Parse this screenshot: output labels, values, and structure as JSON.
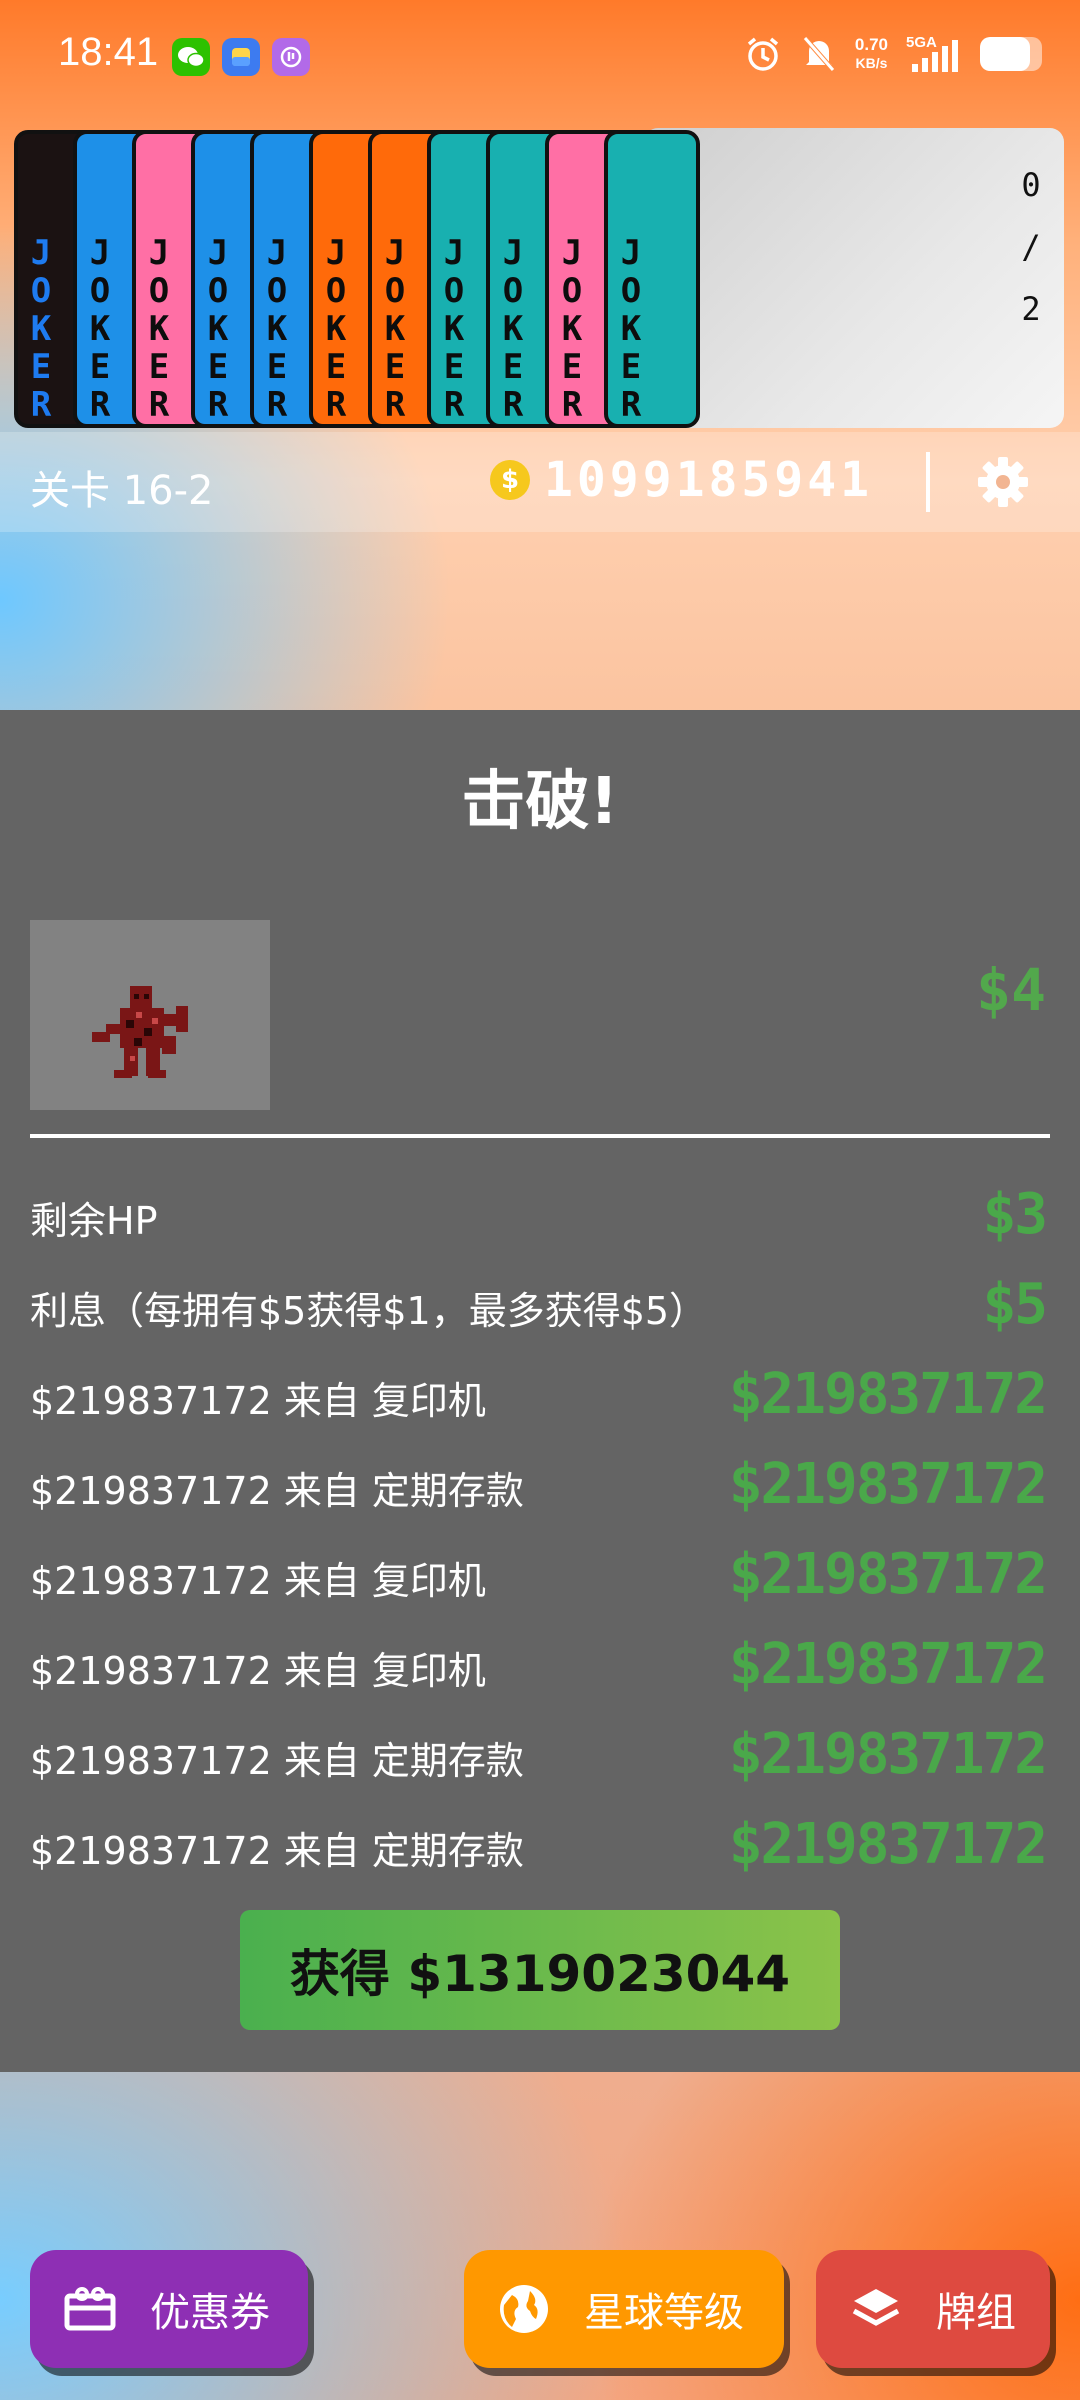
{
  "status_bar": {
    "time": "18:41",
    "net_speed": "0.70",
    "net_unit": "KB/s",
    "network": "5GA",
    "battery_level": 0.8
  },
  "card_strip": {
    "card_label": "JOKER",
    "card_colors": [
      "#1b1212",
      "#1e90e8",
      "#ff6fa5",
      "#1e90e8",
      "#1e90e8",
      "#ff6a0a",
      "#ff6a0a",
      "#18b0b0",
      "#18b0b0",
      "#ff6fa5",
      "#18b0b0"
    ],
    "progress": "0/2"
  },
  "info_bar": {
    "level": "关卡 16-2",
    "coins": "1099185941"
  },
  "panel": {
    "title": "击破!",
    "monster_reward": "$4",
    "rows": [
      {
        "label": "剩余HP",
        "value": "$3"
      },
      {
        "label": "利息（每拥有$5获得$1，最多获得$5）",
        "value": "$5"
      },
      {
        "label": "$219837172 来自 复印机",
        "value": "$219837172"
      },
      {
        "label": "$219837172 来自 定期存款",
        "value": "$219837172"
      },
      {
        "label": "$219837172 来自 复印机",
        "value": "$219837172"
      },
      {
        "label": "$219837172 来自 复印机",
        "value": "$219837172"
      },
      {
        "label": "$219837172 来自 定期存款",
        "value": "$219837172"
      },
      {
        "label": "$219837172 来自 定期存款",
        "value": "$219837172"
      }
    ],
    "collect_label": "获得 $1319023044"
  },
  "bottom_nav": {
    "coupon": "优惠券",
    "planet_level": "星球等级",
    "deck": "牌组"
  },
  "colors": {
    "coupon": "#8e2fb4",
    "planet": "#ff9800",
    "deck": "#de4a40",
    "money_green": "#4aa84a"
  }
}
